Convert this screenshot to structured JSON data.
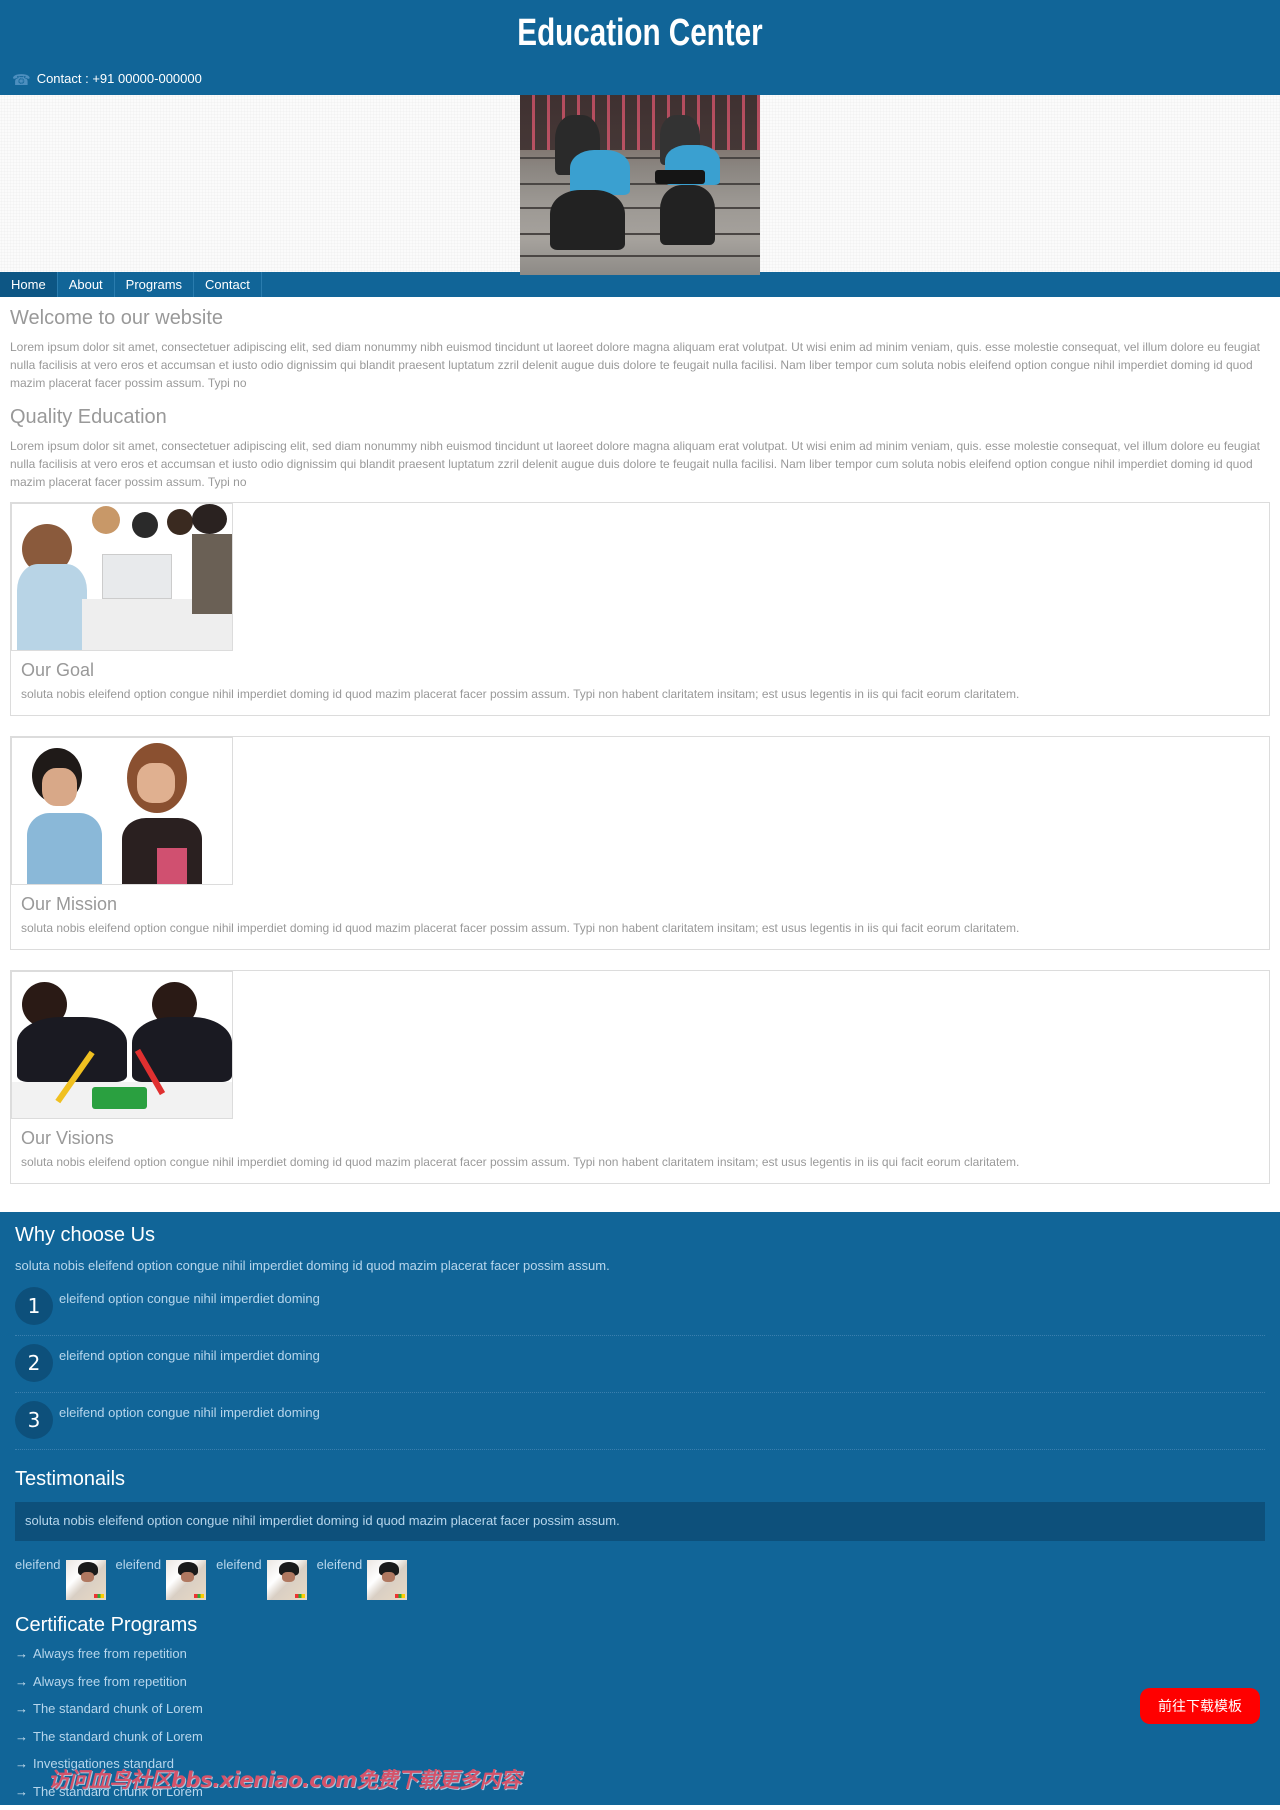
{
  "header": {
    "title": "Education Center",
    "contact_icon": "phone-icon",
    "contact": "Contact : +91 00000-000000"
  },
  "nav": {
    "items": [
      {
        "label": "Home",
        "active": true
      },
      {
        "label": "About",
        "active": false
      },
      {
        "label": "Programs",
        "active": false
      },
      {
        "label": "Contact",
        "active": false
      }
    ]
  },
  "welcome": {
    "title": "Welcome to our website",
    "text": "Lorem ipsum dolor sit amet, consectetuer adipiscing elit, sed diam nonummy nibh euismod tincidunt ut laoreet dolore magna aliquam erat volutpat. Ut wisi enim ad minim veniam, quis. esse molestie consequat, vel illum dolore eu feugiat nulla facilisis at vero eros et accumsan et iusto odio dignissim qui blandit praesent luptatum zzril delenit augue duis dolore te feugait nulla facilisi. Nam liber tempor cum soluta nobis eleifend option congue nihil imperdiet doming id quod mazim placerat facer possim assum. Typi no"
  },
  "quality": {
    "title": "Quality Education",
    "text": "Lorem ipsum dolor sit amet, consectetuer adipiscing elit, sed diam nonummy nibh euismod tincidunt ut laoreet dolore magna aliquam erat volutpat. Ut wisi enim ad minim veniam, quis. esse molestie consequat, vel illum dolore eu feugiat nulla facilisis at vero eros et accumsan et iusto odio dignissim qui blandit praesent luptatum zzril delenit augue duis dolore te feugait nulla facilisi. Nam liber tempor cum soluta nobis eleifend option congue nihil imperdiet doming id quod mazim placerat facer possim assum. Typi no"
  },
  "cards": [
    {
      "title": "Our Goal",
      "text": "soluta nobis eleifend option congue nihil imperdiet doming id quod mazim placerat facer possim assum. Typi non habent claritatem insitam; est usus legentis in iis qui facit eorum claritatem."
    },
    {
      "title": "Our Mission",
      "text": "soluta nobis eleifend option congue nihil imperdiet doming id quod mazim placerat facer possim assum. Typi non habent claritatem insitam; est usus legentis in iis qui facit eorum claritatem."
    },
    {
      "title": "Our Visions",
      "text": "soluta nobis eleifend option congue nihil imperdiet doming id quod mazim placerat facer possim assum. Typi non habent claritatem insitam; est usus legentis in iis qui facit eorum claritatem."
    }
  ],
  "why": {
    "title": "Why choose Us",
    "subtitle": "soluta nobis eleifend option congue nihil imperdiet doming id quod mazim placerat facer possim assum.",
    "items": [
      {
        "num": "1",
        "text": "eleifend option congue nihil imperdiet doming"
      },
      {
        "num": "2",
        "text": "eleifend option congue nihil imperdiet doming"
      },
      {
        "num": "3",
        "text": "eleifend option congue nihil imperdiet doming"
      }
    ]
  },
  "testimonials": {
    "title": "Testimonails",
    "quote": "soluta nobis eleifend option congue nihil imperdiet doming id quod mazim placerat facer possim assum.",
    "people": [
      {
        "name": "eleifend"
      },
      {
        "name": "eleifend"
      },
      {
        "name": "eleifend"
      },
      {
        "name": "eleifend"
      }
    ]
  },
  "certificates": {
    "title": "Certificate Programs",
    "arrow": "→",
    "items": [
      "Always free from repetition",
      "Always free from repetition",
      "The standard chunk of Lorem",
      "The standard chunk of Lorem",
      "Investigationes standard",
      "The standard chunk of Lorem"
    ]
  },
  "download_button": "前往下载模板",
  "watermark": "访问血鸟社区bbs.xieniao.com免费下载更多内容",
  "colors": {
    "primary": "#116598",
    "dark": "#0d507b",
    "download": "#ff0000"
  }
}
